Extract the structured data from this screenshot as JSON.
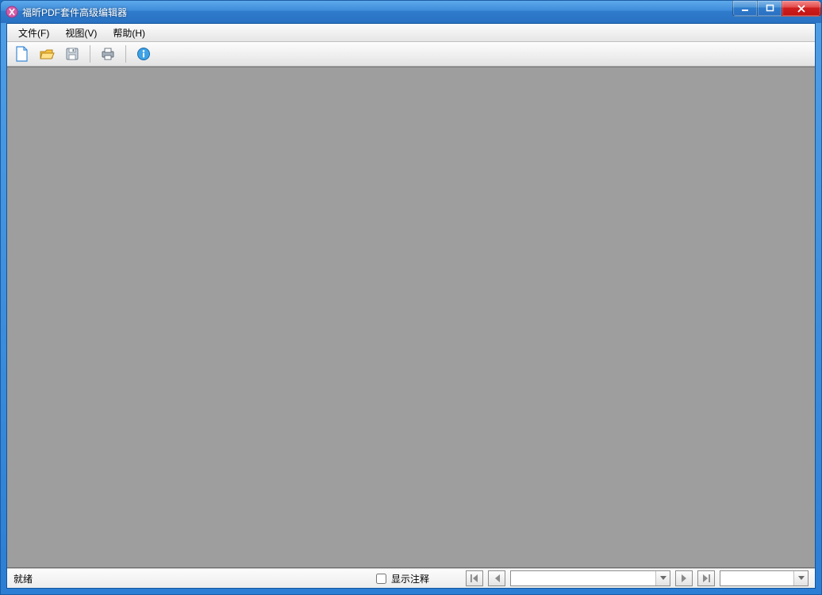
{
  "window": {
    "title": "福昕PDF套件高级编辑器"
  },
  "menubar": {
    "items": [
      {
        "label": "文件(F)"
      },
      {
        "label": "视图(V)"
      },
      {
        "label": "帮助(H)"
      }
    ]
  },
  "toolbar": {
    "buttons": [
      {
        "name": "new-file-icon"
      },
      {
        "name": "open-file-icon"
      },
      {
        "name": "save-file-icon"
      },
      {
        "name": "separator"
      },
      {
        "name": "print-icon"
      },
      {
        "name": "separator"
      },
      {
        "name": "info-icon"
      }
    ]
  },
  "statusbar": {
    "ready_label": "就绪",
    "show_annotations_label": "显示注释",
    "show_annotations_checked": false,
    "page_value": "",
    "zoom_value": ""
  },
  "window_controls": {
    "minimize": "minimize",
    "maximize": "maximize",
    "close": "close"
  }
}
